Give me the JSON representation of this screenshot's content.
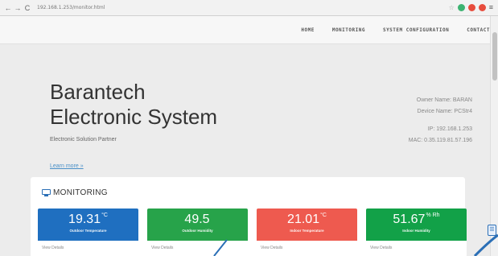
{
  "browser": {
    "url": "192.168.1.253/monitor.html",
    "back": "←",
    "forward": "→",
    "reload": "C",
    "menu": "≡",
    "extension_colors": [
      "#3cb371",
      "#e74c3c",
      "#e74c3c"
    ]
  },
  "nav": {
    "items": [
      "HOME",
      "MONITORING",
      "SYSTEM CONFIGURATION",
      "CONTACT"
    ]
  },
  "hero": {
    "brand_line1": "Barantech",
    "brand_line2": "Electronic System",
    "tagline": "Electronic Solution Partner",
    "learn_more": "Learn more »",
    "owner_name": "Owner Name: BARAN",
    "device_name": "Device Name: PCStr4",
    "ip": "IP: 192.168.1.253",
    "mac": "MAC: 0.35.119.81.57.196"
  },
  "monitoring": {
    "title": "MONITORING",
    "icon": "monitor-icon",
    "cards": [
      {
        "value": "19.31",
        "unit": "°C",
        "label": "Outdoor Temperature",
        "footer": "View Details",
        "color": "#1f6fc0"
      },
      {
        "value": "49.5",
        "unit": "",
        "label": "Outdoor Humidity",
        "footer": "View Details",
        "color": "#27a34a"
      },
      {
        "value": "21.01",
        "unit": "°C",
        "label": "Indoor Temperature",
        "footer": "View Details",
        "color": "#ee5a4f"
      },
      {
        "value": "51.67",
        "unit": "% Rh",
        "label": "Indoor Humidity",
        "footer": "View Details",
        "color": "#12a148"
      }
    ]
  },
  "colors": {
    "accent_blue": "#2b6fb6"
  }
}
